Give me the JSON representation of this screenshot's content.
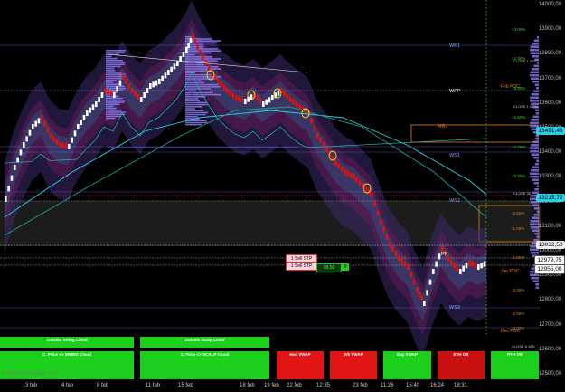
{
  "app": {
    "copyright": "© 2021 NinjaTrader, LLC"
  },
  "colors": {
    "bull": "#ffffff",
    "bear": "#e01010",
    "green": "#22c81e",
    "purple": "#7a6be0",
    "cyan": "#2ad0e8"
  },
  "price_axis": [
    "14000,00",
    "13900,00",
    "13800,00",
    "13700,00",
    "13600,00",
    "13500,00",
    "13400,00",
    "13300,00",
    "13200,00",
    "13100,00",
    "13000,00",
    "12900,00",
    "12800,00",
    "12700,00",
    "12600,00",
    "12500,00"
  ],
  "price_tags": {
    "p1": "13491,46",
    "p2": "13215,72",
    "last": "13032,50",
    "p3": "12979,75",
    "p4": "12955,00"
  },
  "time_axis": [
    "3 feb",
    "4 feb",
    "8 feb",
    "11 feb",
    "15 feb",
    "18 feb",
    "19 feb",
    "22 feb",
    "12:35",
    "23 feb",
    "11:26",
    "15:40",
    "16:24",
    "18:31"
  ],
  "pivot_labels": {
    "wr1": "WR1",
    "wpp": "WPP",
    "mr1": "MR1",
    "ws1": "WS1",
    "ws2": "WS2",
    "pp": "PP",
    "ws3": "WS3"
  },
  "poc_labels": {
    "feb": "Feb POC",
    "jan": "Jan POC",
    "dec": "Dec POC"
  },
  "pct_labels": [
    "+3.00%",
    "+2.50%",
    "+2.00%",
    "+1.50%",
    "+1.00%",
    "+0.50%",
    "-0.50%",
    "-1.00%",
    "-1.50%",
    "-2.00%",
    "-2.50%",
    "-3.00%"
  ],
  "close_labels": {
    "c1": "CLOSE 1 WTD",
    "c2": "CLOSE 1 WTD",
    "c3": "CLOSE 30",
    "c4": "CLOSE 8 JAN"
  },
  "orders": {
    "sell1": "1 Sell STP",
    "sell2": "1 Sell STP",
    "qty_price": "09.50",
    "qty_count": "0"
  },
  "buttons": {
    "outside_swing": "Outside Swing Cloud",
    "outside_scalp": "Outside Scalp Cloud",
    "price_swing": "C. Price <> SWING Cloud",
    "price_scalp": "C. Price <> SCALP Cloud",
    "hod_vwap": "Hod VWAP",
    "wk_vwap": "Wk VWAP",
    "day_vwap": "Day VWAP",
    "eth_or": "ETH OR",
    "rth_or": "RTH OR"
  }
}
